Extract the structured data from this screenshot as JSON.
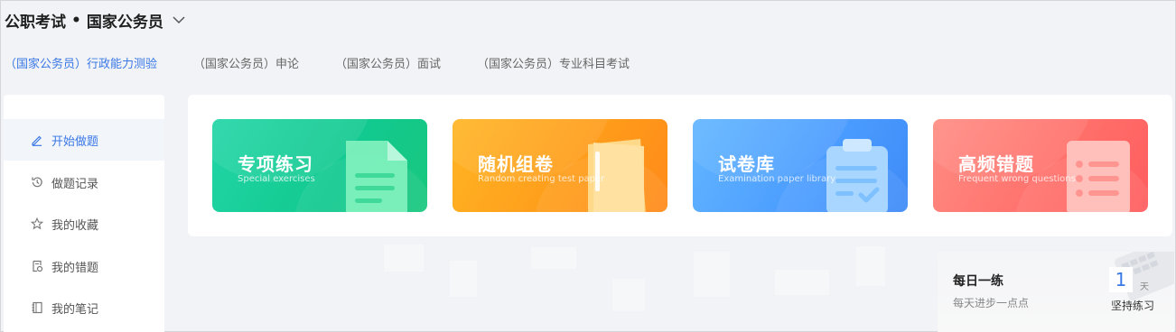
{
  "header": {
    "category": "公职考试",
    "separator": "•",
    "subject": "国家公务员"
  },
  "exam_tabs": [
    {
      "label": "（国家公务员）行政能力测验",
      "active": true
    },
    {
      "label": "（国家公务员）申论",
      "active": false
    },
    {
      "label": "（国家公务员）面试",
      "active": false
    },
    {
      "label": "（国家公务员）专业科目考试",
      "active": false
    }
  ],
  "sidebar": {
    "items": [
      {
        "label": "开始做题",
        "icon": "pencil-icon",
        "active": true
      },
      {
        "label": "做题记录",
        "icon": "history-icon",
        "active": false
      },
      {
        "label": "我的收藏",
        "icon": "star-icon",
        "active": false
      },
      {
        "label": "我的错题",
        "icon": "wrong-questions-icon",
        "active": false
      },
      {
        "label": "我的笔记",
        "icon": "notebook-icon",
        "active": false
      }
    ]
  },
  "cards": [
    {
      "title": "专项练习",
      "subtitle": "Special exercises",
      "color": "#12c98f",
      "icon": "document-icon"
    },
    {
      "title": "随机组卷",
      "subtitle": "Random creating test paper",
      "color": "#ff9b1a",
      "icon": "folder-icon"
    },
    {
      "title": "试卷库",
      "subtitle": "Examination paper library",
      "color": "#4a9bff",
      "icon": "clipboard-check-icon"
    },
    {
      "title": "高频错题",
      "subtitle": "Frequent wrong questions",
      "color": "#ff6f6a",
      "icon": "list-icon"
    }
  ],
  "daily_practice": {
    "title": "每日一练",
    "subtitle": "每天进步一点点",
    "days_count": "1",
    "days_unit": "天",
    "keep_label": "坚持练习"
  },
  "colors": {
    "accent": "#3a78e6",
    "background": "#f1f3f6"
  }
}
